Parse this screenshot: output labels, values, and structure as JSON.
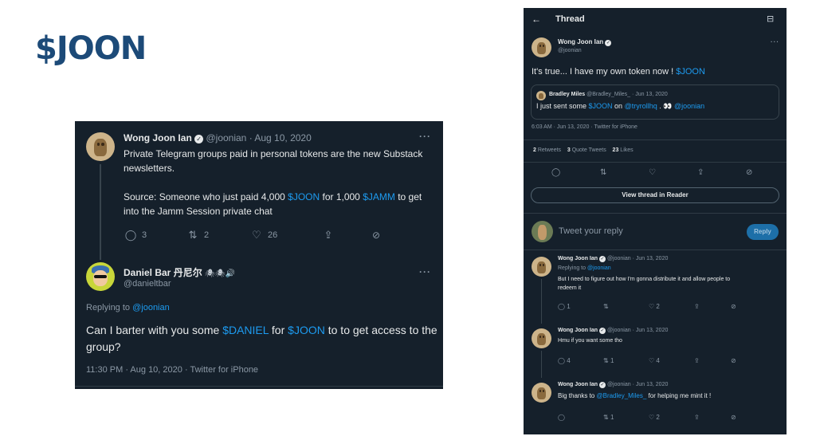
{
  "slide": {
    "title": "$JOON"
  },
  "left": {
    "tweet1": {
      "name": "Wong Joon Ian",
      "handle": "@joonian",
      "sep": "·",
      "date": "Aug 10, 2020",
      "more": "···",
      "line1": "Private Telegram groups paid in personal tokens are the new Substack",
      "line2": "newsletters.",
      "source_pre": "Source: Someone who just paid 4,000 ",
      "source_t1": "$JOON",
      "source_mid": " for 1,000 ",
      "source_t2": "$JAMM",
      "source_post": " to get",
      "line4": "into the Jamm Session private chat",
      "replies": "3",
      "retweets": "2",
      "likes": "26"
    },
    "tweet2": {
      "name": "Daniel Bar 丹尼尔",
      "name_emoji": "🕷🕷🔊",
      "handle": "@danieltbar",
      "more": "···",
      "replying_label": "Replying to ",
      "replying_to": "@joonian",
      "text_pre": "Can I barter with you some ",
      "text_t1": "$DANIEL",
      "text_mid": " for ",
      "text_t2": "$JOON",
      "text_post": " to to get access to the",
      "text_line2": "group?",
      "timestamp": "11:30 PM · Aug 10, 2020 · Twitter for iPhone"
    }
  },
  "right": {
    "header": {
      "back": "←",
      "title": "Thread",
      "reader_icon": "⊟"
    },
    "main_tweet": {
      "name": "Wong Joon Ian",
      "handle": "@joonian",
      "more": "···",
      "text_pre": "It's true... I have my own token now ! ",
      "text_token": "$JOON",
      "quote": {
        "name": "Bradley Miles",
        "handle": "@Bradley_Miles_",
        "date": "· Jun 13, 2020",
        "text_pre": "I just sent some ",
        "text_t1": "$JOON",
        "text_mid": " on ",
        "text_t2": "@tryrollhq",
        "text_post": " . 👀 ",
        "text_t3": "@joonian"
      },
      "timestamp": "6:03 AM · Jun 13, 2020 · Twitter for iPhone",
      "stats": {
        "retweets_count": "2",
        "retweets_label": "Retweets",
        "quotes_count": "3",
        "quotes_label": "Quote Tweets",
        "likes_count": "23",
        "likes_label": "Likes"
      }
    },
    "view_thread_label": "View thread in Reader",
    "compose": {
      "placeholder": "Tweet your reply",
      "reply_label": "Reply"
    },
    "replies": [
      {
        "name": "Wong Joon Ian",
        "handle": "@joonian",
        "date": "· Jun 13, 2020",
        "replying_label": "Replying to ",
        "replying_to": "@joonian",
        "line1": "But I need to figure out how I'm gonna distribute it and allow people to",
        "line2": "redeem it",
        "replies": "1",
        "retweets": "",
        "likes": "2"
      },
      {
        "name": "Wong Joon Ian",
        "handle": "@joonian",
        "date": "· Jun 13, 2020",
        "line1": "Hmu if you want some tho",
        "replies": "4",
        "retweets": "1",
        "likes": "4"
      },
      {
        "name": "Wong Joon Ian",
        "handle": "@joonian",
        "date": "· Jun 13, 2020",
        "text_pre": "Big thanks to ",
        "text_link": "@Bradley_Miles_",
        "text_post": " for helping me mint it !",
        "replies": "",
        "retweets": "1",
        "likes": "2"
      }
    ]
  }
}
